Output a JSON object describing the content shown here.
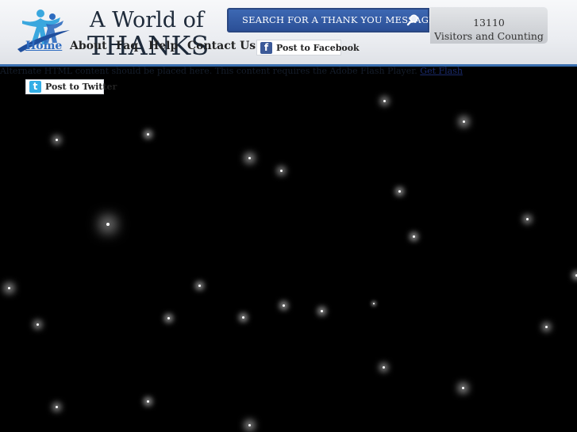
{
  "logo": {
    "line1": "A World of",
    "line2": "THANKS"
  },
  "nav": {
    "items": [
      "Home",
      "About",
      "Faq",
      "Help",
      "Contact Us"
    ]
  },
  "facebook": {
    "icon_letter": "f",
    "label": "Post to Facebook"
  },
  "search": {
    "label": "SEARCH FOR A THANK YOU MESSAGE"
  },
  "counter": {
    "count": "13110",
    "label": "Visitors and Counting"
  },
  "flash": {
    "message": "Alternate HTML content should be placed here. This content requires the Adobe Flash Player.",
    "link": "Get Flash"
  },
  "twitter": {
    "icon_letter": "t",
    "label": "Post to Twitter"
  },
  "colors": {
    "header_accent": "#3a6fb0",
    "search_blue": "#2b4f96",
    "active_nav": "#2f6cc0",
    "background": "#000000"
  }
}
